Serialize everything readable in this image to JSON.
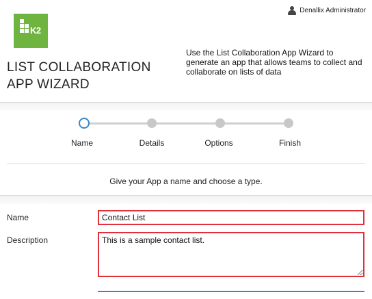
{
  "user": {
    "name": "Denallix Administrator",
    "icon": "person-icon"
  },
  "logo": {
    "text": "K2",
    "color": "#6fb43f"
  },
  "header": {
    "title": "LIST COLLABORATION APP WIZARD",
    "description": "Use the List Collaboration App Wizard to generate an app that allows teams to collect and collaborate on lists of data"
  },
  "steps": [
    {
      "label": "Name",
      "active": true
    },
    {
      "label": "Details",
      "active": false
    },
    {
      "label": "Options",
      "active": false
    },
    {
      "label": "Finish",
      "active": false
    }
  ],
  "instruction": "Give your App a name and choose a type.",
  "form": {
    "name_label": "Name",
    "name_value": "Contact List",
    "description_label": "Description",
    "description_value": "This is a sample contact list."
  },
  "colors": {
    "accent": "#3b86c9",
    "error_border": "#e0303a",
    "brand": "#6fb43f"
  }
}
